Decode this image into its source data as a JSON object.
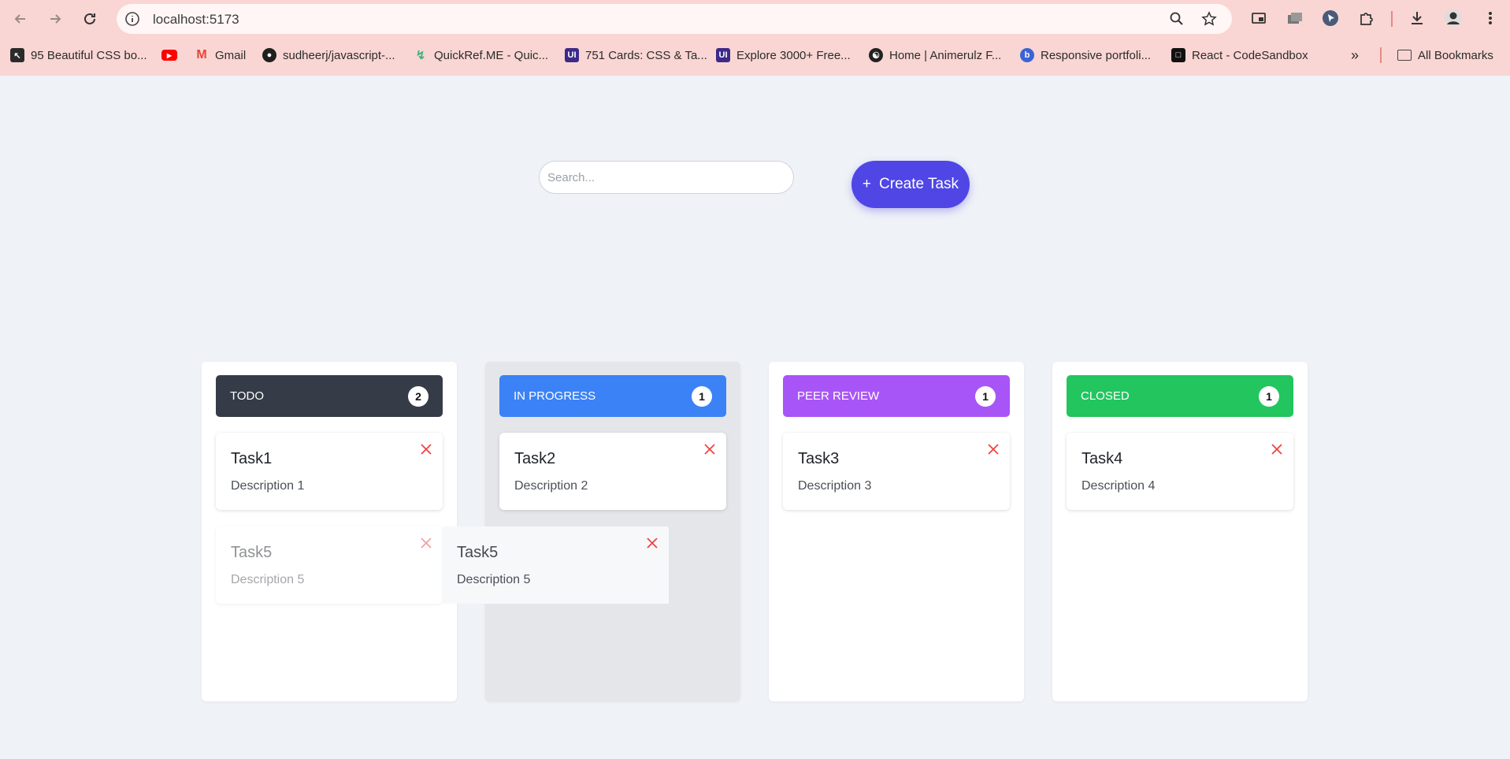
{
  "browser": {
    "url": "localhost:5173",
    "bookmarks": [
      {
        "label": "95 Beautiful CSS bo...",
        "icon": "codepen-icon",
        "color": "#2b2b2b"
      },
      {
        "label": "",
        "icon": "youtube-icon",
        "color": "#ff0000"
      },
      {
        "label": "Gmail",
        "icon": "gmail-icon",
        "color": "#ea4335"
      },
      {
        "label": "sudheerj/javascript-...",
        "icon": "github-icon",
        "color": "#1f1f1f"
      },
      {
        "label": "QuickRef.ME - Quic...",
        "icon": "quickref-icon",
        "color": "#3fb37f"
      },
      {
        "label": "751 Cards: CSS & Ta...",
        "icon": "uiverse-icon",
        "color": "#3b2a8a"
      },
      {
        "label": "Explore 3000+ Free...",
        "icon": "uiverse-icon",
        "color": "#3b2a8a"
      },
      {
        "label": "Home | Animerulz F...",
        "icon": "yinyang-icon",
        "color": "#222222"
      },
      {
        "label": "Responsive portfoli...",
        "icon": "bing-icon",
        "color": "#3b63d6"
      },
      {
        "label": "React - CodeSandbox",
        "icon": "codesandbox-icon",
        "color": "#111111"
      }
    ],
    "all_bookmarks_label": "All Bookmarks"
  },
  "search": {
    "placeholder": "Search..."
  },
  "create_button": {
    "icon": "+",
    "label": "Create Task"
  },
  "columns": [
    {
      "title": "TODO",
      "count": "2",
      "color": "#353c48"
    },
    {
      "title": "IN PROGRESS",
      "count": "1",
      "color": "#3b82f6"
    },
    {
      "title": "PEER REVIEW",
      "count": "1",
      "color": "#a855f7"
    },
    {
      "title": "CLOSED",
      "count": "1",
      "color": "#22c55e"
    }
  ],
  "tasks": [
    {
      "title": "Task1",
      "description": "Description 1"
    },
    {
      "title": "Task2",
      "description": "Description 2"
    },
    {
      "title": "Task3",
      "description": "Description 3"
    },
    {
      "title": "Task4",
      "description": "Description 4"
    },
    {
      "title": "Task5",
      "description": "Description 5"
    }
  ],
  "dragging_task": {
    "title": "Task5",
    "description": "Description 5"
  },
  "colors": {
    "delete": "#ef4444",
    "accent": "#4f46e5"
  }
}
